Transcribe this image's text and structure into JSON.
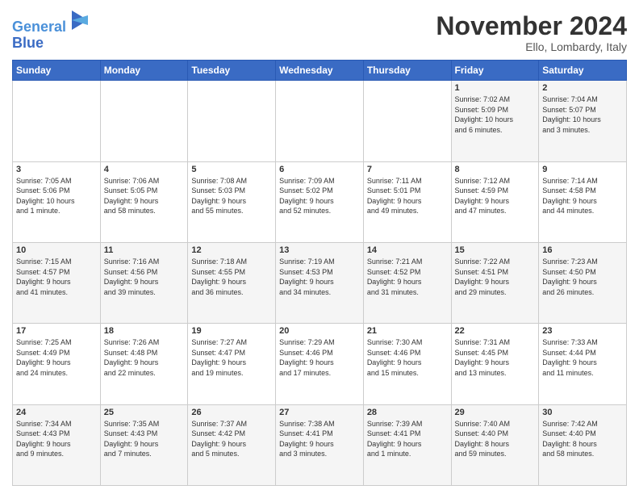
{
  "header": {
    "logo_line1": "General",
    "logo_line2": "Blue",
    "month_title": "November 2024",
    "location": "Ello, Lombardy, Italy"
  },
  "days_of_week": [
    "Sunday",
    "Monday",
    "Tuesday",
    "Wednesday",
    "Thursday",
    "Friday",
    "Saturday"
  ],
  "weeks": [
    [
      {
        "day": "",
        "info": ""
      },
      {
        "day": "",
        "info": ""
      },
      {
        "day": "",
        "info": ""
      },
      {
        "day": "",
        "info": ""
      },
      {
        "day": "",
        "info": ""
      },
      {
        "day": "1",
        "info": "Sunrise: 7:02 AM\nSunset: 5:09 PM\nDaylight: 10 hours\nand 6 minutes."
      },
      {
        "day": "2",
        "info": "Sunrise: 7:04 AM\nSunset: 5:07 PM\nDaylight: 10 hours\nand 3 minutes."
      }
    ],
    [
      {
        "day": "3",
        "info": "Sunrise: 7:05 AM\nSunset: 5:06 PM\nDaylight: 10 hours\nand 1 minute."
      },
      {
        "day": "4",
        "info": "Sunrise: 7:06 AM\nSunset: 5:05 PM\nDaylight: 9 hours\nand 58 minutes."
      },
      {
        "day": "5",
        "info": "Sunrise: 7:08 AM\nSunset: 5:03 PM\nDaylight: 9 hours\nand 55 minutes."
      },
      {
        "day": "6",
        "info": "Sunrise: 7:09 AM\nSunset: 5:02 PM\nDaylight: 9 hours\nand 52 minutes."
      },
      {
        "day": "7",
        "info": "Sunrise: 7:11 AM\nSunset: 5:01 PM\nDaylight: 9 hours\nand 49 minutes."
      },
      {
        "day": "8",
        "info": "Sunrise: 7:12 AM\nSunset: 4:59 PM\nDaylight: 9 hours\nand 47 minutes."
      },
      {
        "day": "9",
        "info": "Sunrise: 7:14 AM\nSunset: 4:58 PM\nDaylight: 9 hours\nand 44 minutes."
      }
    ],
    [
      {
        "day": "10",
        "info": "Sunrise: 7:15 AM\nSunset: 4:57 PM\nDaylight: 9 hours\nand 41 minutes."
      },
      {
        "day": "11",
        "info": "Sunrise: 7:16 AM\nSunset: 4:56 PM\nDaylight: 9 hours\nand 39 minutes."
      },
      {
        "day": "12",
        "info": "Sunrise: 7:18 AM\nSunset: 4:55 PM\nDaylight: 9 hours\nand 36 minutes."
      },
      {
        "day": "13",
        "info": "Sunrise: 7:19 AM\nSunset: 4:53 PM\nDaylight: 9 hours\nand 34 minutes."
      },
      {
        "day": "14",
        "info": "Sunrise: 7:21 AM\nSunset: 4:52 PM\nDaylight: 9 hours\nand 31 minutes."
      },
      {
        "day": "15",
        "info": "Sunrise: 7:22 AM\nSunset: 4:51 PM\nDaylight: 9 hours\nand 29 minutes."
      },
      {
        "day": "16",
        "info": "Sunrise: 7:23 AM\nSunset: 4:50 PM\nDaylight: 9 hours\nand 26 minutes."
      }
    ],
    [
      {
        "day": "17",
        "info": "Sunrise: 7:25 AM\nSunset: 4:49 PM\nDaylight: 9 hours\nand 24 minutes."
      },
      {
        "day": "18",
        "info": "Sunrise: 7:26 AM\nSunset: 4:48 PM\nDaylight: 9 hours\nand 22 minutes."
      },
      {
        "day": "19",
        "info": "Sunrise: 7:27 AM\nSunset: 4:47 PM\nDaylight: 9 hours\nand 19 minutes."
      },
      {
        "day": "20",
        "info": "Sunrise: 7:29 AM\nSunset: 4:46 PM\nDaylight: 9 hours\nand 17 minutes."
      },
      {
        "day": "21",
        "info": "Sunrise: 7:30 AM\nSunset: 4:46 PM\nDaylight: 9 hours\nand 15 minutes."
      },
      {
        "day": "22",
        "info": "Sunrise: 7:31 AM\nSunset: 4:45 PM\nDaylight: 9 hours\nand 13 minutes."
      },
      {
        "day": "23",
        "info": "Sunrise: 7:33 AM\nSunset: 4:44 PM\nDaylight: 9 hours\nand 11 minutes."
      }
    ],
    [
      {
        "day": "24",
        "info": "Sunrise: 7:34 AM\nSunset: 4:43 PM\nDaylight: 9 hours\nand 9 minutes."
      },
      {
        "day": "25",
        "info": "Sunrise: 7:35 AM\nSunset: 4:43 PM\nDaylight: 9 hours\nand 7 minutes."
      },
      {
        "day": "26",
        "info": "Sunrise: 7:37 AM\nSunset: 4:42 PM\nDaylight: 9 hours\nand 5 minutes."
      },
      {
        "day": "27",
        "info": "Sunrise: 7:38 AM\nSunset: 4:41 PM\nDaylight: 9 hours\nand 3 minutes."
      },
      {
        "day": "28",
        "info": "Sunrise: 7:39 AM\nSunset: 4:41 PM\nDaylight: 9 hours\nand 1 minute."
      },
      {
        "day": "29",
        "info": "Sunrise: 7:40 AM\nSunset: 4:40 PM\nDaylight: 8 hours\nand 59 minutes."
      },
      {
        "day": "30",
        "info": "Sunrise: 7:42 AM\nSunset: 4:40 PM\nDaylight: 8 hours\nand 58 minutes."
      }
    ]
  ]
}
